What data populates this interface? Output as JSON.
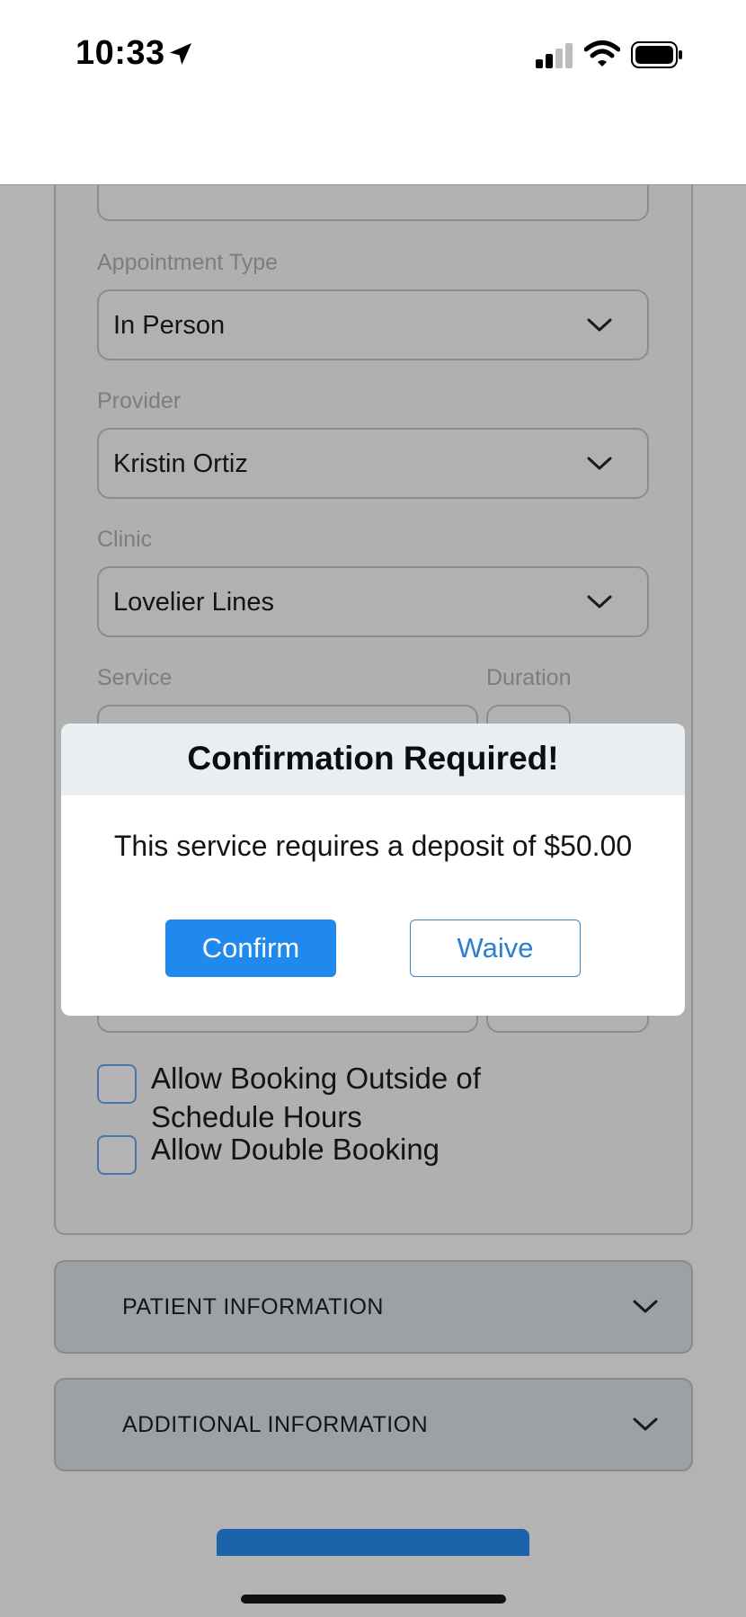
{
  "status_bar": {
    "time": "10:33",
    "icons": [
      "location-arrow-icon",
      "signal-icon",
      "wifi-icon",
      "battery-icon"
    ]
  },
  "form": {
    "appointment_type": {
      "label": "Appointment Type",
      "value": "In Person"
    },
    "provider": {
      "label": "Provider",
      "value": "Kristin Ortiz"
    },
    "clinic": {
      "label": "Clinic",
      "value": "Lovelier Lines"
    },
    "service": {
      "label": "Service"
    },
    "duration": {
      "label": "Duration"
    },
    "checkboxes": [
      {
        "label": "Allow Booking Outside of Schedule Hours",
        "checked": false
      },
      {
        "label": "Allow Double Booking",
        "checked": false
      }
    ]
  },
  "sections": [
    {
      "title": "PATIENT INFORMATION"
    },
    {
      "title": "ADDITIONAL INFORMATION"
    }
  ],
  "modal": {
    "title": "Confirmation Required!",
    "message": "This service requires a deposit of $50.00",
    "confirm_label": "Confirm",
    "waive_label": "Waive"
  },
  "colors": {
    "primary": "#2089ee",
    "overlay": "#b3b3b3",
    "modal_header": "#e8eef2"
  }
}
